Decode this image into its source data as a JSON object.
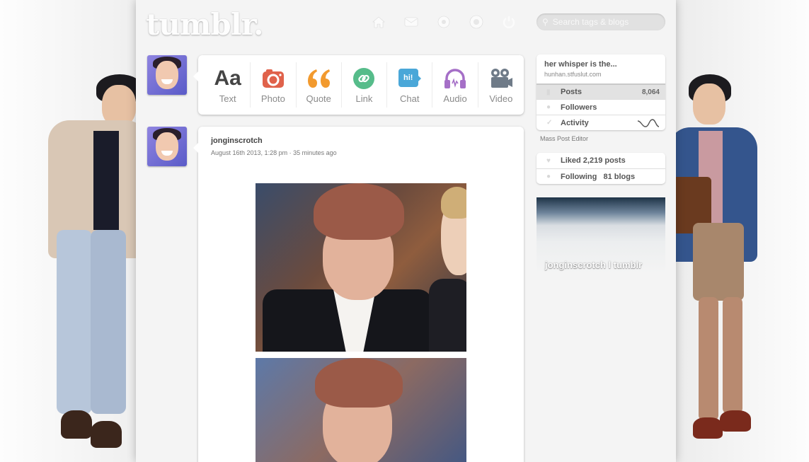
{
  "header": {
    "logo": "tumblr.",
    "search_placeholder": "Search tags & blogs",
    "nav": [
      "home-icon",
      "mail-icon",
      "compass-icon",
      "account-icon",
      "power-icon"
    ]
  },
  "post_box": {
    "items": [
      {
        "label": "Text",
        "icon": "text-icon",
        "glyph": "Aa"
      },
      {
        "label": "Photo",
        "icon": "camera-icon"
      },
      {
        "label": "Quote",
        "icon": "quote-icon",
        "glyph": "66"
      },
      {
        "label": "Link",
        "icon": "link-icon"
      },
      {
        "label": "Chat",
        "icon": "chat-icon",
        "glyph": "hi!"
      },
      {
        "label": "Audio",
        "icon": "headphones-icon"
      },
      {
        "label": "Video",
        "icon": "video-camera-icon"
      }
    ]
  },
  "post": {
    "author": "jonginscrotch",
    "date": "August 16th 2013, 1:28 pm · 35 minutes ago"
  },
  "sidebar": {
    "blog_title": "her whisper is the...",
    "blog_url": "hunhan.stfuslut.com",
    "rows": [
      {
        "label": "Posts",
        "count": "8,064"
      },
      {
        "label": "Followers",
        "count": ""
      },
      {
        "label": "Activity",
        "count": ""
      }
    ],
    "mass_post_editor": "Mass Post Editor",
    "stats": [
      {
        "label": "Liked 2,219 posts"
      },
      {
        "label": "Following   81 blogs"
      }
    ],
    "banner_text": "jonginscrotch l tumblr"
  },
  "colors": {
    "photo_icon": "#e0624b",
    "quote_icon": "#f29a2e",
    "link_icon": "#56bc8a",
    "chat_icon": "#4aa7d8",
    "audio_icon": "#a56fc7",
    "video_icon": "#6f7b88",
    "text_icon": "#444444"
  }
}
